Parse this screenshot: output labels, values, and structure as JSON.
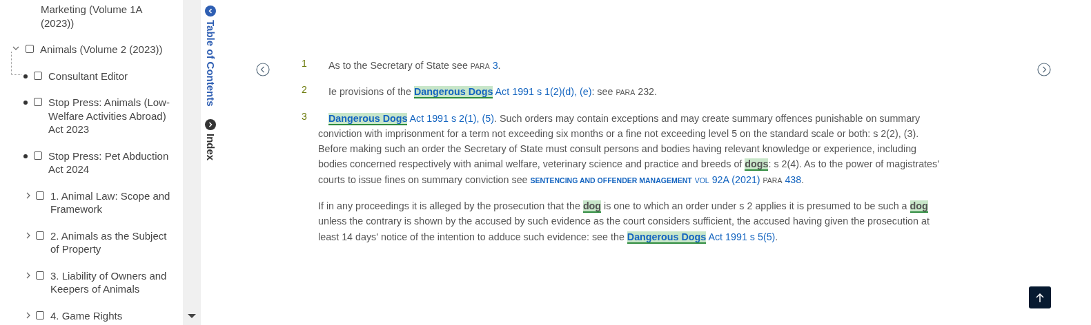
{
  "toc": {
    "items": [
      {
        "kind": "continued",
        "label": "Marketing (Volume 1A (2023))"
      },
      {
        "kind": "branch",
        "label": "Animals (Volume 2 (2023))",
        "checked": false,
        "expanded": true,
        "children": [
          {
            "kind": "leaf",
            "label": "Consultant Editor",
            "checked": false
          },
          {
            "kind": "leaf",
            "label": "Stop Press: Animals (Low-Welfare Activities Abroad) Act 2023",
            "checked": false
          },
          {
            "kind": "leaf",
            "label": "Stop Press: Pet Abduction Act 2024",
            "checked": false
          },
          {
            "kind": "branch",
            "label": "1. Animal Law: Scope and Framework",
            "checked": false,
            "expanded": false
          },
          {
            "kind": "branch",
            "label": "2. Animals as the Subject of Property",
            "checked": false,
            "expanded": false
          },
          {
            "kind": "branch",
            "label": "3. Liability of Owners and Keepers of Animals",
            "checked": false,
            "expanded": false
          },
          {
            "kind": "branch",
            "label": "4. Game Rights",
            "checked": false,
            "expanded": false
          }
        ]
      }
    ]
  },
  "side_tabs": [
    {
      "label": "Table of Contents",
      "selected": true
    },
    {
      "label": "Index",
      "selected": false
    }
  ],
  "footnotes": [
    {
      "number": "1",
      "paragraphs": [
        [
          {
            "kind": "text",
            "text": "As to the Secretary of State see "
          },
          {
            "kind": "cap",
            "text": "PARA",
            "spaced": true
          },
          {
            "kind": "link",
            "text": "3"
          },
          {
            "kind": "text",
            "text": "."
          }
        ]
      ]
    },
    {
      "number": "2",
      "paragraphs": [
        [
          {
            "kind": "text",
            "text": "Ie provisions of the "
          },
          {
            "kind": "hitlink",
            "text": "Dangerous Dogs",
            "spaced": true
          },
          {
            "kind": "link",
            "text": "Act 1991 s 1(2)(d), (e)"
          },
          {
            "kind": "text",
            "text": ": see "
          },
          {
            "kind": "cap",
            "text": "PARA"
          },
          {
            "kind": "text",
            "text": " 232."
          }
        ]
      ]
    },
    {
      "number": "3",
      "paragraphs": [
        [
          {
            "kind": "hitlink",
            "text": "Dangerous Dogs",
            "spaced": true
          },
          {
            "kind": "link",
            "text": "Act 1991 s 2(1), (5)"
          },
          {
            "kind": "text",
            "text": ". Such orders may contain exceptions and may create summary offences punishable on summary conviction with imprisonment for a term not exceeding six months or a fine not exceeding level 5 on the standard scale or both: s 2(2), (3). Before making such an order the Secretary of State must consult persons and bodies having relevant knowledge or experience, including bodies concerned respectively with animal welfare, veterinary science and practice and breeds of "
          },
          {
            "kind": "hit",
            "text": "dogs"
          },
          {
            "kind": "text",
            "text": ": s 2(4). As to the power of magistrates' courts to issue fines on summary conviction see "
          },
          {
            "kind": "titlelink",
            "text": "SENTENCING AND OFFENDER MANAGEMENT",
            "spaced": true
          },
          {
            "kind": "caplink",
            "text": "VOL",
            "spaced": true
          },
          {
            "kind": "link",
            "text": "92A (2021)",
            "spaced": true
          },
          {
            "kind": "cap",
            "text": "PARA",
            "spaced": true
          },
          {
            "kind": "link",
            "text": "438"
          },
          {
            "kind": "text",
            "text": "."
          }
        ],
        [
          {
            "kind": "text",
            "text": "If in any proceedings it is alleged by the prosecution that the "
          },
          {
            "kind": "hit",
            "text": "dog"
          },
          {
            "kind": "text",
            "text": " is one to which an order under s 2 applies it is presumed to be such a "
          },
          {
            "kind": "hit",
            "text": "dog"
          },
          {
            "kind": "text",
            "text": " unless the contrary is shown by the accused by such evidence as the court considers sufficient, the accused having given the prosecution at least 14 days' notice of the intention to adduce such evidence: see the "
          },
          {
            "kind": "hitlink",
            "text": "Dangerous Dogs",
            "spaced": true
          },
          {
            "kind": "link",
            "text": "Act 1991 s 5(5)"
          },
          {
            "kind": "text",
            "text": "."
          }
        ]
      ]
    }
  ]
}
